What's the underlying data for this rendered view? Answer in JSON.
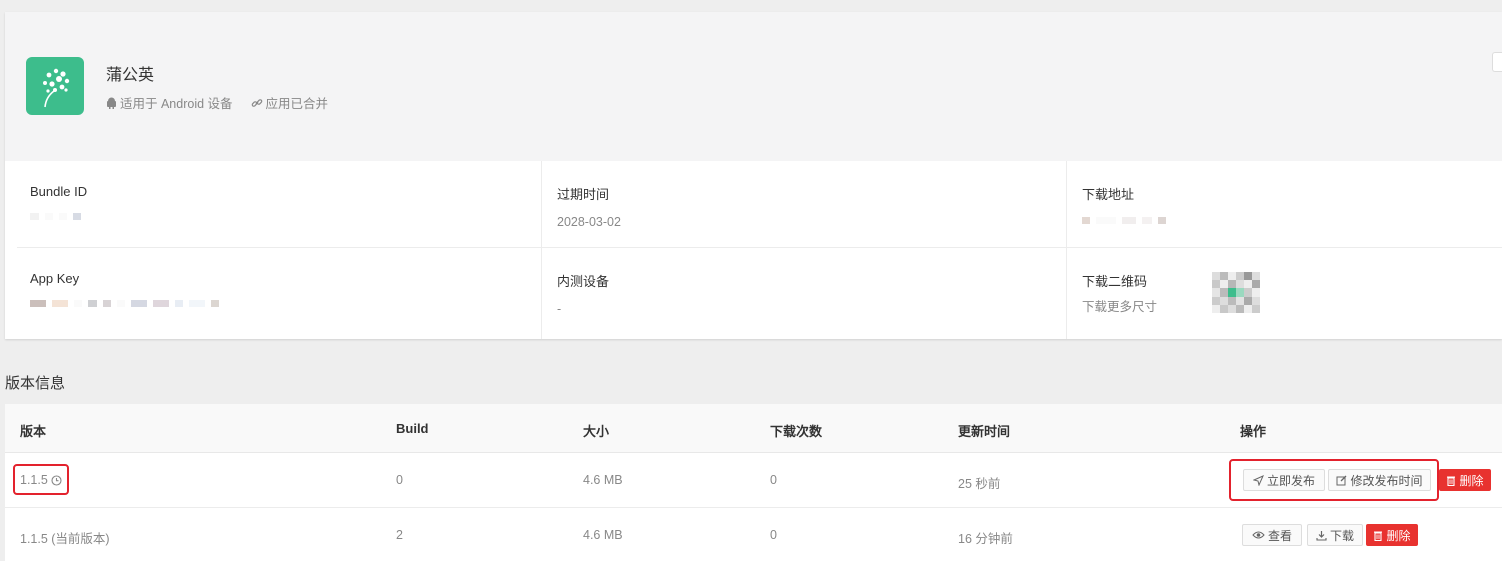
{
  "app": {
    "name": "蒲公英",
    "platform": "适用于 Android 设备",
    "merged": "应用已合并",
    "icon_color": "#3dbd8c"
  },
  "info": {
    "bundle_id_label": "Bundle ID",
    "expire_label": "过期时间",
    "expire_value": "2028-03-02",
    "download_url_label": "下载地址",
    "app_key_label": "App Key",
    "devices_label": "内测设备",
    "devices_value": "-",
    "qrcode_label": "下载二维码",
    "qrcode_more": "下载更多尺寸"
  },
  "versions": {
    "section_title": "版本信息",
    "headers": {
      "version": "版本",
      "build": "Build",
      "size": "大小",
      "downloads": "下载次数",
      "updated": "更新时间",
      "actions": "操作"
    },
    "rows": [
      {
        "version": "1.1.5",
        "build": "0",
        "size": "4.6 MB",
        "downloads": "0",
        "updated": "25 秒前",
        "btn_publish": "立即发布",
        "btn_edit_time": "修改发布时间",
        "btn_delete": "删除"
      },
      {
        "version": "1.1.5 (当前版本)",
        "build": "2",
        "size": "4.6 MB",
        "downloads": "0",
        "updated": "16 分钟前",
        "btn_view": "查看",
        "btn_download": "下载",
        "btn_delete": "删除"
      }
    ]
  },
  "colors": {
    "danger": "#e8322f",
    "annotation": "#e3222d"
  }
}
